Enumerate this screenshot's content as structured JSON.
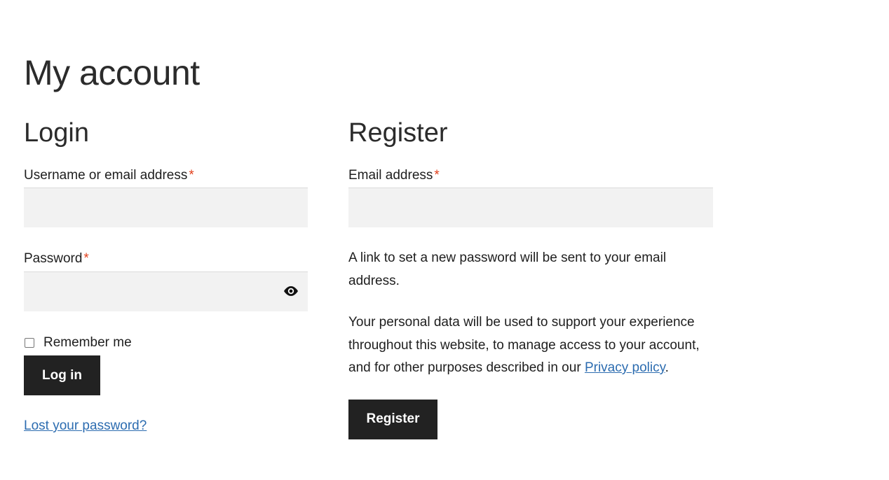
{
  "page": {
    "title": "My account"
  },
  "login": {
    "heading": "Login",
    "username_label": "Username or email address",
    "username_value": "",
    "password_label": "Password",
    "password_value": "",
    "required_mark": "*",
    "remember_label": "Remember me",
    "remember_checked": false,
    "login_button": "Log in",
    "lost_password_link": "Lost your password?"
  },
  "register": {
    "heading": "Register",
    "email_label": "Email address",
    "email_value": "",
    "required_mark": "*",
    "password_notice": "A link to set a new password will be sent to your email address.",
    "privacy_text": "Your personal data will be used to support your experience throughout this website, to manage access to your account, and for other purposes described in our",
    "privacy_link": "Privacy policy",
    "privacy_end": ".",
    "register_button": "Register"
  },
  "icons": {
    "show_password": "eye-icon"
  },
  "colors": {
    "required": "#e2401c",
    "link": "#2c6cb0",
    "button_bg": "#222222",
    "input_bg": "#f2f2f2"
  }
}
